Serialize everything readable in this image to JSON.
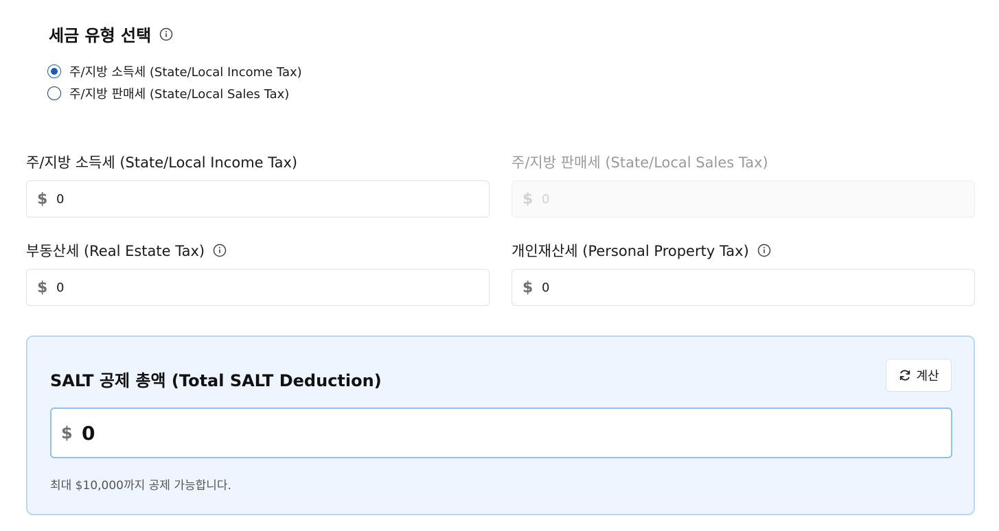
{
  "tax_type": {
    "title": "세금 유형 선택",
    "options": [
      {
        "label": "주/지방 소득세 (State/Local Income Tax)",
        "selected": true
      },
      {
        "label": "주/지방 판매세 (State/Local Sales Tax)",
        "selected": false
      }
    ]
  },
  "fields": {
    "income_tax": {
      "label": "주/지방 소득세 (State/Local Income Tax)",
      "currency": "$",
      "value": "0"
    },
    "sales_tax": {
      "label": "주/지방 판매세 (State/Local Sales Tax)",
      "currency": "$",
      "value": "0"
    },
    "real_estate_tax": {
      "label": "부동산세 (Real Estate Tax)",
      "currency": "$",
      "value": "0"
    },
    "personal_property_tax": {
      "label": "개인재산세 (Personal Property Tax)",
      "currency": "$",
      "value": "0"
    }
  },
  "total": {
    "title": "SALT 공제 총액 (Total SALT Deduction)",
    "calc_button_label": "계산",
    "currency": "$",
    "value": "0",
    "note": "최대 $10,000까지 공제 가능합니다."
  },
  "icons": {
    "info": "info-circle-icon",
    "refresh": "refresh-icon"
  },
  "colors": {
    "accent": "#1f5bb5",
    "panel_bg": "#eef5ff",
    "panel_border": "#b9d8f3",
    "total_input_border": "#8cc2ec"
  }
}
